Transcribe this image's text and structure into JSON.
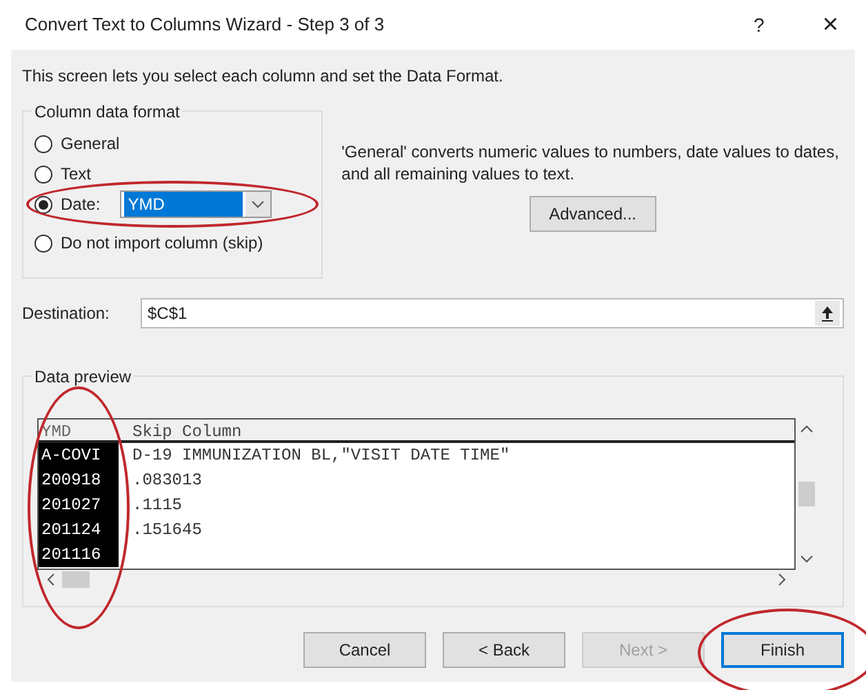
{
  "window": {
    "title": "Convert Text to Columns Wizard - Step 3 of 3",
    "help": "?",
    "close": "×"
  },
  "intro": "This screen lets you select each column and set the Data Format.",
  "format_group": {
    "title": "Column data format",
    "options": [
      {
        "label": "General",
        "selected": false
      },
      {
        "label": "Text",
        "selected": false
      },
      {
        "label": "Date:",
        "selected": true,
        "kind": "date",
        "value": "YMD",
        "circled": true
      },
      {
        "label": "Do not import column (skip)",
        "selected": false
      }
    ]
  },
  "hint": "'General' converts numeric values to numbers, date values to dates, and all remaining values to text.",
  "advanced_button": "Advanced...",
  "destination": {
    "label": "Destination:",
    "value": "$C$1"
  },
  "preview": {
    "title": "Data preview",
    "columns": [
      {
        "label": "YMD",
        "selected": true,
        "circled": true
      },
      {
        "label": "Skip Column",
        "selected": false
      }
    ],
    "rows": [
      [
        "A-COVI",
        "D-19 IMMUNIZATION BL,\"VISIT DATE TIME\""
      ],
      [
        "200918",
        ".083013"
      ],
      [
        "201027",
        ".1115"
      ],
      [
        "201124",
        ".151645"
      ],
      [
        "201116",
        ""
      ]
    ]
  },
  "buttons": [
    {
      "label": "Cancel",
      "disabled": false,
      "default": false
    },
    {
      "label": "< Back",
      "disabled": false,
      "default": false
    },
    {
      "label": "Next >",
      "disabled": true,
      "default": false
    },
    {
      "label": "Finish",
      "disabled": false,
      "default": true,
      "circled": true
    }
  ]
}
